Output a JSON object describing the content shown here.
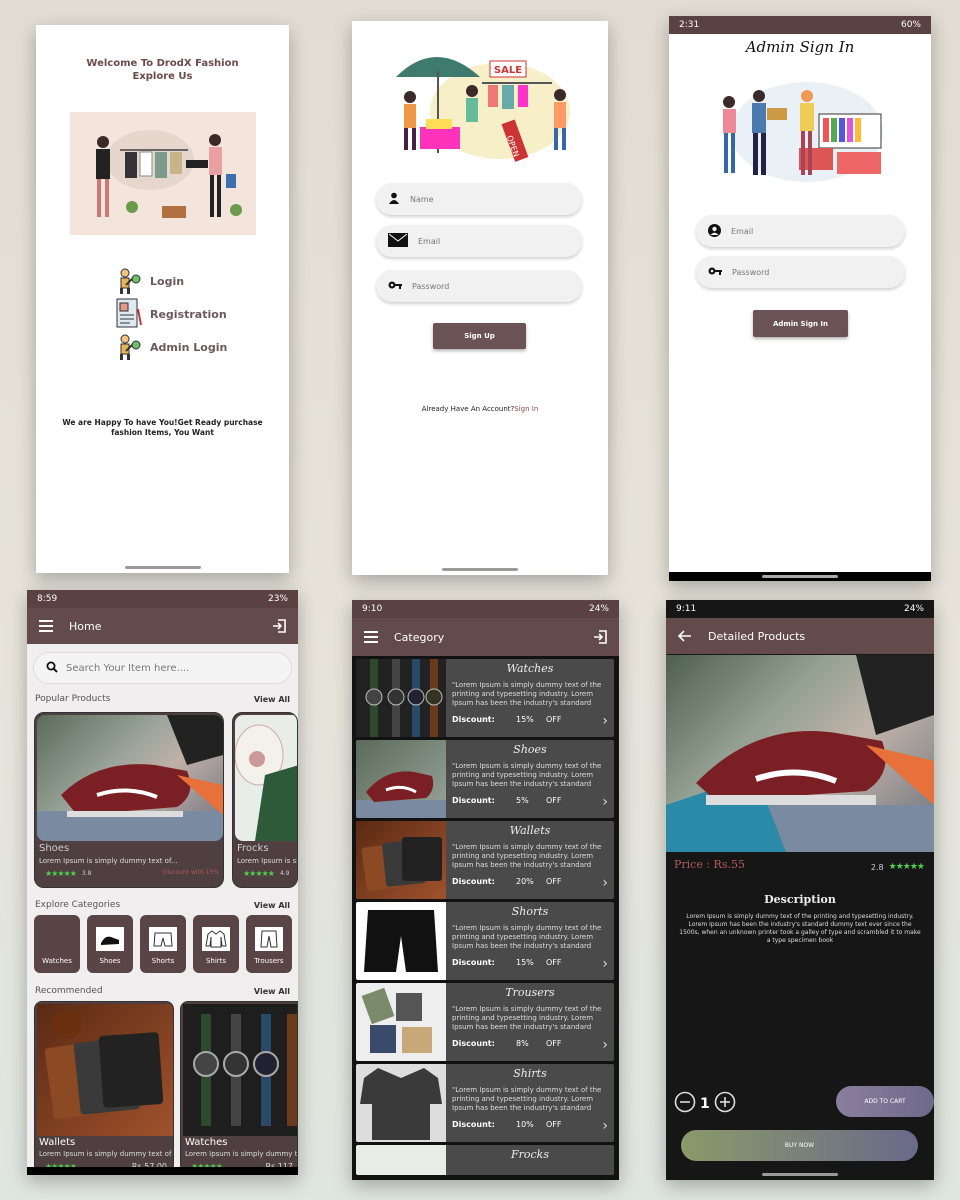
{
  "welcome": {
    "title_line1": "Welcome To DrodX Fashion",
    "title_line2": "Explore Us",
    "menu": [
      {
        "label": "Login",
        "icon": "key-person-icon"
      },
      {
        "label": "Registration",
        "icon": "registration-form-icon"
      },
      {
        "label": "Admin Login",
        "icon": "key-person-icon"
      }
    ],
    "footer_text": "We are Happy To have You!Get Ready purchase fashion Items, You Want"
  },
  "signup": {
    "banner_sale": "SALE",
    "banner_open": "OPEN",
    "fields": [
      {
        "placeholder": "Name",
        "icon": "person-icon"
      },
      {
        "placeholder": "Email",
        "icon": "envelope-icon"
      },
      {
        "placeholder": "Password",
        "icon": "key-icon"
      }
    ],
    "button": "Sign Up",
    "footer_prefix": "Already Have An Account?",
    "footer_link": "Sign In"
  },
  "admin": {
    "status_time": "2:31",
    "status_right": "60%",
    "title": "Admin Sign In",
    "fields": [
      {
        "placeholder": "Email",
        "icon": "account-circle-icon"
      },
      {
        "placeholder": "Password",
        "icon": "key-icon"
      }
    ],
    "button": "Admin Sign In"
  },
  "home": {
    "status_time": "8:59",
    "status_right": "23%",
    "title": "Home",
    "search_placeholder": "Search Your Item here....",
    "popular": {
      "label": "Popular Products",
      "view_all": "View All"
    },
    "products": [
      {
        "name": "Shoes",
        "desc": "Lorem Ipsum is simply dummy text of...",
        "rating": "3.8",
        "extra": "Discount with 15%"
      },
      {
        "name": "Frocks",
        "desc": "Lorem Ipsum is simply dummy text of...",
        "rating": "4.9"
      }
    ],
    "categories_head": {
      "label": "Explore Categories",
      "view_all": "View All"
    },
    "categories": [
      "Watches",
      "Shoes",
      "Shorts",
      "Shirts",
      "Trousers"
    ],
    "recommended_head": {
      "label": "Recommended",
      "view_all": "View All"
    },
    "recommended": [
      {
        "name": "Wallets",
        "desc": "Lorem Ipsum is simply dummy text of t...",
        "price": "Rs.57.00"
      },
      {
        "name": "Watches",
        "desc": "Lorem Ipsum is simply dummy text of...",
        "price": "Rs.117"
      }
    ]
  },
  "category": {
    "status_time": "9:10",
    "status_right": "24%",
    "title": "Category",
    "discount_label": "Discount:",
    "off_label": "OFF",
    "desc": "\"Lorem Ipsum is simply dummy text of the printing and typesetting industry. Lorem Ipsum has been the industry's standard dummy text ever since",
    "items": [
      {
        "title": "Watches",
        "pct": "15%"
      },
      {
        "title": "Shoes",
        "pct": "5%"
      },
      {
        "title": "Wallets",
        "pct": "20%"
      },
      {
        "title": "Shorts",
        "pct": "15%"
      },
      {
        "title": "Trousers",
        "pct": "8%"
      },
      {
        "title": "Shirts",
        "pct": "10%"
      },
      {
        "title": "Frocks",
        "pct": ""
      }
    ]
  },
  "detail": {
    "status_time": "9:11",
    "status_right": "24%",
    "title": "Detailed Products",
    "price": "Price : Rs.55",
    "rating": "2.8",
    "desc_title": "Description",
    "desc": "Lorem Ipsum is simply dummy text of the printing and typesetting industry. Lorem Ipsum has been the industry's standard dummy text ever since the 1500s, when an unknown printer took a galley of type and scrambled it to make a type specimen book",
    "qty": "1",
    "add_to_cart": "ADD TO CART",
    "buy_now": "BUY NOW"
  },
  "colors": {
    "brand": "#634a4b",
    "star": "#4fd04f",
    "price": "#b05a5a"
  }
}
